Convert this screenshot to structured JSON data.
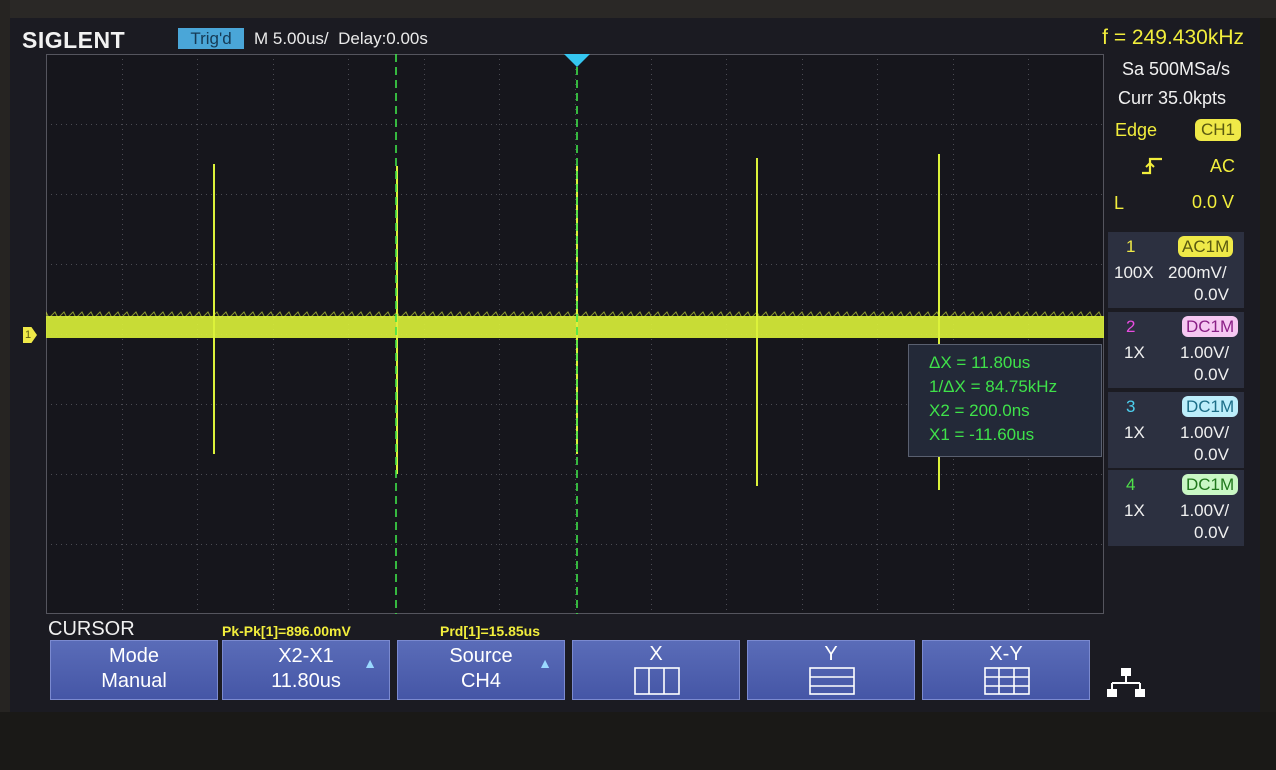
{
  "header": {
    "brand": "SIGLENT",
    "trigger_status": "Trig'd",
    "timebase": "M 5.00us/",
    "delay": "Delay:0.00s",
    "frequency": "f = 249.430kHz"
  },
  "acquisition": {
    "sample_rate": "Sa 500MSa/s",
    "memory_depth": "Curr 35.0kpts"
  },
  "trigger": {
    "type": "Edge",
    "source": "CH1",
    "slope_icon": "rising-edge-icon",
    "coupling": "AC",
    "level_label": "L",
    "level": "0.0 V"
  },
  "channels": [
    {
      "num": "1",
      "coupling": "AC1M",
      "probe": "100X",
      "vdiv": "200mV/",
      "offset": "0.0V",
      "color": "#efe948"
    },
    {
      "num": "2",
      "coupling": "DC1M",
      "probe": "1X",
      "vdiv": "1.00V/",
      "offset": "0.0V",
      "color": "#e84ce0"
    },
    {
      "num": "3",
      "coupling": "DC1M",
      "probe": "1X",
      "vdiv": "1.00V/",
      "offset": "0.0V",
      "color": "#4dcfee"
    },
    {
      "num": "4",
      "coupling": "DC1M",
      "probe": "1X",
      "vdiv": "1.00V/",
      "offset": "0.0V",
      "color": "#4fe24a"
    }
  ],
  "ground_marker": "1",
  "cursor_readout": {
    "dx": "ΔX = 11.80us",
    "inv_dx": "1/ΔX = 84.75kHz",
    "x2": "X2 = 200.0ns",
    "x1": "X1 = -11.60us"
  },
  "menu": {
    "title": "CURSOR",
    "measurements": {
      "pkpk": "Pk-Pk[1]=896.00mV",
      "prd": "Prd[1]=15.85us"
    },
    "softkeys": [
      {
        "line1": "Mode",
        "line2": "Manual"
      },
      {
        "line1": "X2-X1",
        "line2": "11.80us"
      },
      {
        "line1": "Source",
        "line2": "CH4"
      },
      {
        "line1": "X",
        "icon": "x-cursor-icon"
      },
      {
        "line1": "Y",
        "icon": "y-cursor-icon"
      },
      {
        "line1": "X-Y",
        "icon": "xy-cursor-icon"
      }
    ],
    "network_icon": "network-icon"
  },
  "colors": {
    "trace": "#dcf23a",
    "cursor": "#3fe24a",
    "trigger_marker": "#35c6f0",
    "softkey": "#4a5cae"
  }
}
